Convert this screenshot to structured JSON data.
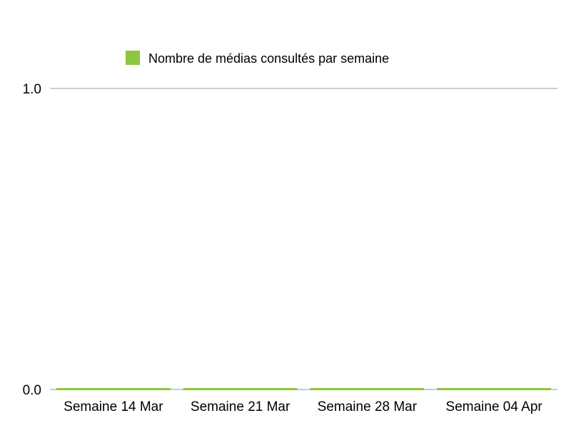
{
  "chart_data": {
    "type": "bar",
    "title": "",
    "xlabel": "",
    "ylabel": "",
    "categories": [
      "Semaine 14 Mar",
      "Semaine 21 Mar",
      "Semaine 28 Mar",
      "Semaine 04 Apr"
    ],
    "series": [
      {
        "name": "Nombre de médias consultés par semaine",
        "values": [
          0,
          0,
          0,
          0
        ],
        "color": "#8dc63f"
      }
    ],
    "ylim": [
      0,
      1
    ],
    "yticks": [
      "0.0",
      "1.0"
    ],
    "grid": true,
    "legend_position": "top",
    "colors": {
      "series": "#8dc63f",
      "grid": "#999999",
      "axis": "#999999",
      "text": "#000000"
    }
  }
}
